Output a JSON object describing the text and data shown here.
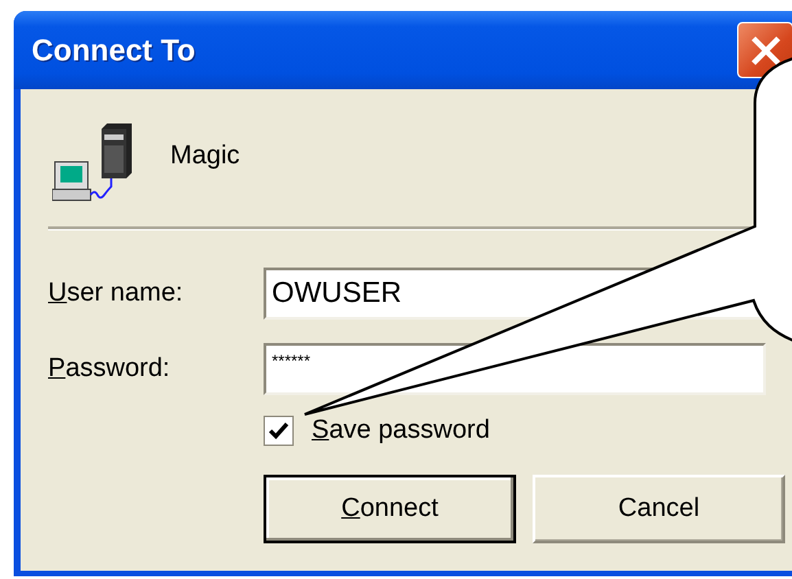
{
  "window": {
    "title": "Connect To"
  },
  "server": {
    "name": "Magic"
  },
  "fields": [
    {
      "kind": "text",
      "label": {
        "accel": "U",
        "rest": "ser name:"
      },
      "value": "OWUSER"
    },
    {
      "kind": "password",
      "label": {
        "accel": "P",
        "rest": "assword:"
      },
      "value": "******"
    }
  ],
  "save_password": {
    "label": {
      "accel": "S",
      "rest": "ave password"
    },
    "checked": true
  },
  "buttons": [
    {
      "label": {
        "accel": "C",
        "rest": "onnect"
      },
      "default": true
    },
    {
      "label": {
        "rest": "Cancel"
      },
      "default": false
    }
  ]
}
